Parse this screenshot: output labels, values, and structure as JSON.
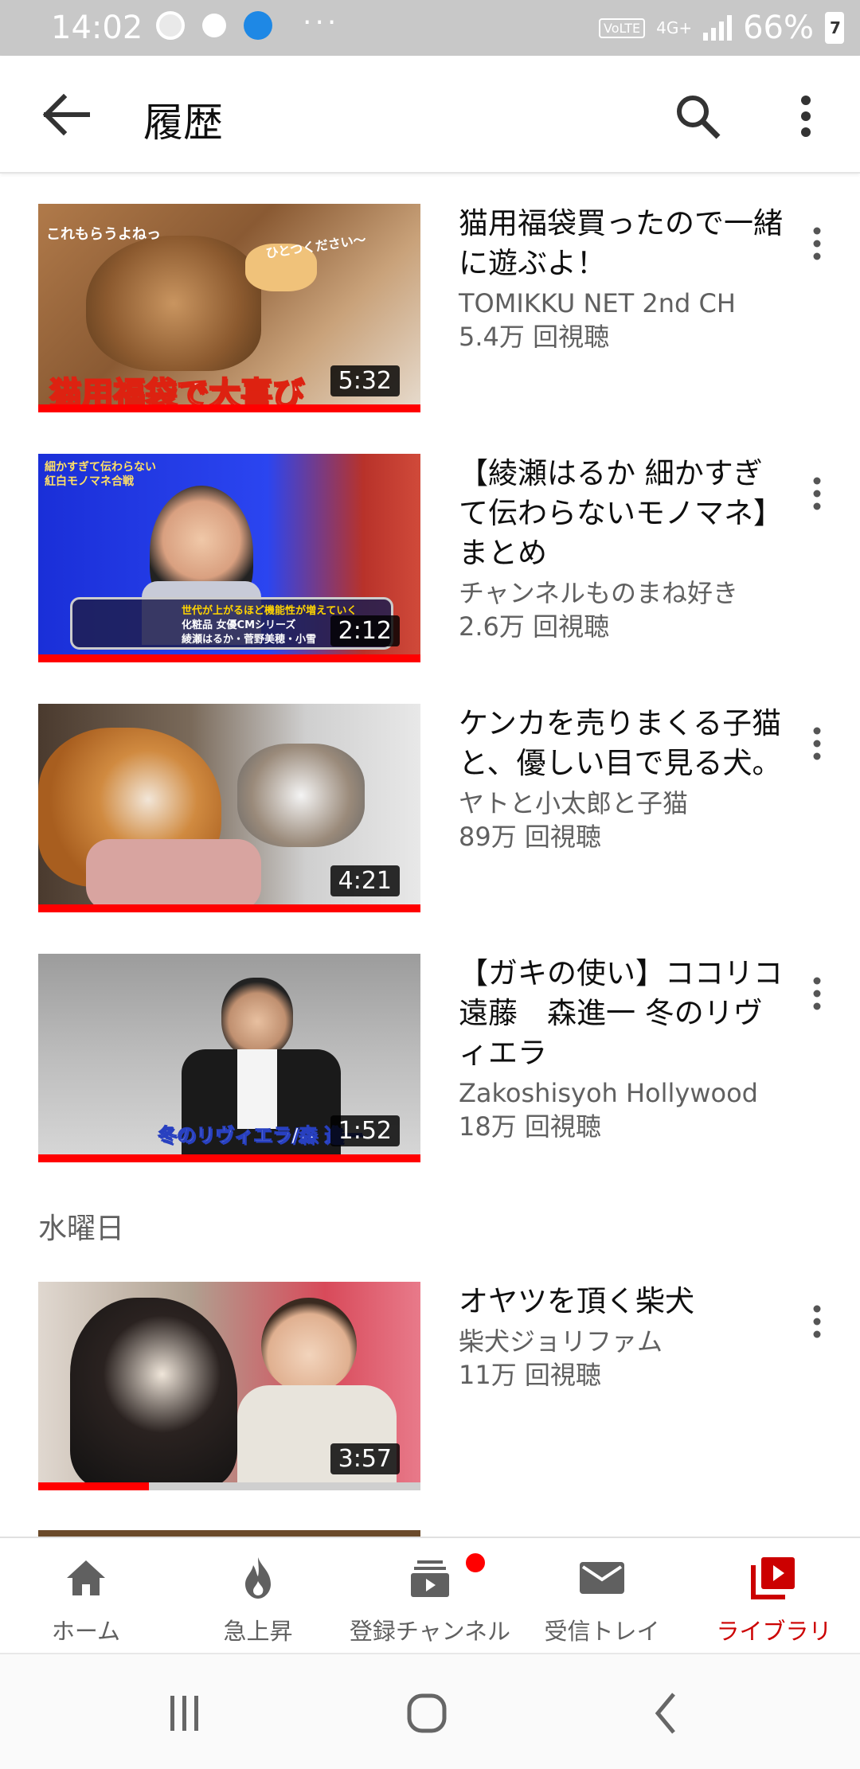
{
  "status_bar": {
    "time": "14:02",
    "more_indicator": "···",
    "volte": "VoLTE",
    "network": "4G+",
    "battery_percent": "66%",
    "battery_level": "7",
    "icons": [
      "chrome-icon",
      "bot-icon",
      "globe-app-icon"
    ]
  },
  "app_bar": {
    "title": "履歴",
    "icons": [
      "back-arrow-icon",
      "search-icon",
      "more-vert-icon"
    ]
  },
  "videos": [
    {
      "title": "猫用福袋買ったので一緒に遊ぶよ！",
      "channel": "TOMIKKU NET 2nd CH",
      "views": "5.4万 回視聴",
      "duration": "5:32",
      "watched_fraction": 1.0,
      "thumb_caption": "猫用福袋で大喜び",
      "thumb_text_a": "これもらうよねっ",
      "thumb_text_b": "ひとつください〜"
    },
    {
      "title": "【綾瀬はるか 細かすぎて伝わらないモノマネ】まとめ",
      "channel": "チャンネルものまね好き",
      "views": "2.6万 回視聴",
      "duration": "2:12",
      "watched_fraction": 1.0,
      "thumb_text_a": "細かすぎて伝わらない",
      "thumb_text_b": "紅白モノマネ合戦",
      "thumb_text_c": "世代が上がるほど機能性が増えていく",
      "thumb_text_d": "化粧品 女優CMシリーズ",
      "thumb_text_e": "綾瀬はるか・菅野美穂・小雪"
    },
    {
      "title": "ケンカを売りまくる子猫と、優しい目で見る犬。",
      "channel": "ヤトと小太郎と子猫",
      "views": "89万 回視聴",
      "duration": "4:21",
      "watched_fraction": 1.0
    },
    {
      "title": "【ガキの使い】ココリコ遠藤　森進一 冬のリヴィエラ",
      "channel": "Zakoshisyoh Hollywood",
      "views": "18万 回視聴",
      "duration": "1:52",
      "watched_fraction": 1.0,
      "thumb_caption": "冬のリヴィエラ/森 進一"
    },
    {
      "title": "オヤツを頂く柴犬",
      "channel": "柴犬ジョリファム",
      "views": "11万 回視聴",
      "duration": "3:57",
      "watched_fraction": 0.29
    }
  ],
  "section": {
    "label": "水曜日"
  },
  "bottom_nav": [
    {
      "label": "ホーム",
      "icon": "home-icon",
      "active": false
    },
    {
      "label": "急上昇",
      "icon": "trending-flame-icon",
      "active": false
    },
    {
      "label": "登録チャンネル",
      "icon": "subscriptions-icon",
      "active": false,
      "badge": true
    },
    {
      "label": "受信トレイ",
      "icon": "inbox-mail-icon",
      "active": false
    },
    {
      "label": "ライブラリ",
      "icon": "library-play-icon",
      "active": true
    }
  ],
  "system_nav": [
    "recents-icon",
    "home-circle-icon",
    "back-chevron-icon"
  ],
  "colors": {
    "accent_red": "#ff0000",
    "active_label": "#cc0000",
    "text_primary": "#0f0f0f",
    "text_secondary": "#606060",
    "status_bar": "#c8c8c8"
  }
}
